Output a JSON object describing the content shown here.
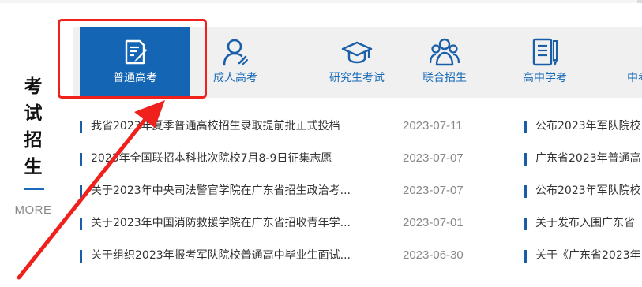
{
  "section": {
    "title_chars": [
      "考",
      "试",
      "招",
      "生"
    ],
    "more": "MORE"
  },
  "tabs": [
    {
      "label": "普通高考",
      "icon": "exam-paper-pen-icon",
      "active": true
    },
    {
      "label": "成人高考",
      "icon": "adult-person-icon",
      "active": false
    },
    {
      "label": "研究生考试",
      "icon": "graduation-cap-icon",
      "active": false
    },
    {
      "label": "联合招生",
      "icon": "group-people-icon",
      "active": false
    },
    {
      "label": "高中学考",
      "icon": "notebook-pen-icon",
      "active": false
    },
    {
      "label": "中考",
      "icon": "",
      "active": false
    }
  ],
  "news_left": [
    {
      "title": "我省2023年夏季普通高校招生录取提前批正式投档",
      "date": "2023-07-11"
    },
    {
      "title": "2023年全国联招本科批次院校7月8-9日征集志愿",
      "date": "2023-07-07"
    },
    {
      "title": "关于2023年中央司法警官学院在广东省招生政治考...",
      "date": "2023-07-07"
    },
    {
      "title": "关于2023年中国消防救援学院在广东省招收青年学...",
      "date": "2023-07-01"
    },
    {
      "title": "关于组织2023年报考军队院校普通高中毕业生面试...",
      "date": "2023-06-30"
    }
  ],
  "news_right": [
    {
      "title": "公布2023年军队院校"
    },
    {
      "title": "广东省2023年普通高"
    },
    {
      "title": "公布2023年军队院校"
    },
    {
      "title": "关于发布入围广东省"
    },
    {
      "title": "关于《广东省2023年"
    }
  ],
  "colors": {
    "brand_blue": "#1466b5",
    "tab_label_blue": "#1a6bb8",
    "annotation_red": "#f0211d"
  }
}
